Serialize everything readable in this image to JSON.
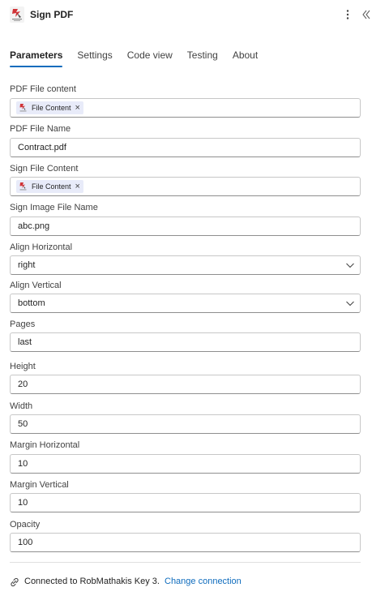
{
  "header": {
    "title": "Sign PDF",
    "more_icon": "more-vertical-icon",
    "collapse_icon": "collapse-double-chevron-icon"
  },
  "tabs": [
    {
      "label": "Parameters",
      "active": true
    },
    {
      "label": "Settings",
      "active": false
    },
    {
      "label": "Code view",
      "active": false
    },
    {
      "label": "Testing",
      "active": false
    },
    {
      "label": "About",
      "active": false
    }
  ],
  "fields": {
    "pdf_file_content": {
      "label": "PDF File content",
      "token": "File Content"
    },
    "pdf_file_name": {
      "label": "PDF File Name",
      "value": "Contract.pdf"
    },
    "sign_file_content": {
      "label": "Sign File Content",
      "token": "File Content"
    },
    "sign_image_file_name": {
      "label": "Sign Image File Name",
      "value": "abc.png"
    },
    "align_horizontal": {
      "label": "Align Horizontal",
      "value": "right"
    },
    "align_vertical": {
      "label": "Align Vertical",
      "value": "bottom"
    },
    "pages": {
      "label": "Pages",
      "value": "last"
    },
    "height": {
      "label": "Height",
      "value": "20"
    },
    "width": {
      "label": "Width",
      "value": "50"
    },
    "margin_horizontal": {
      "label": "Margin Horizontal",
      "value": "10"
    },
    "margin_vertical": {
      "label": "Margin Vertical",
      "value": "10"
    },
    "opacity": {
      "label": "Opacity",
      "value": "100"
    }
  },
  "footer": {
    "connection_text": "Connected to RobMathakis Key 3.",
    "change_link": "Change connection",
    "icon": "link-connection-icon"
  },
  "colors": {
    "accent": "#0f6cbd",
    "token_bg": "#e8ebf9",
    "logo_red": "#d13438"
  }
}
